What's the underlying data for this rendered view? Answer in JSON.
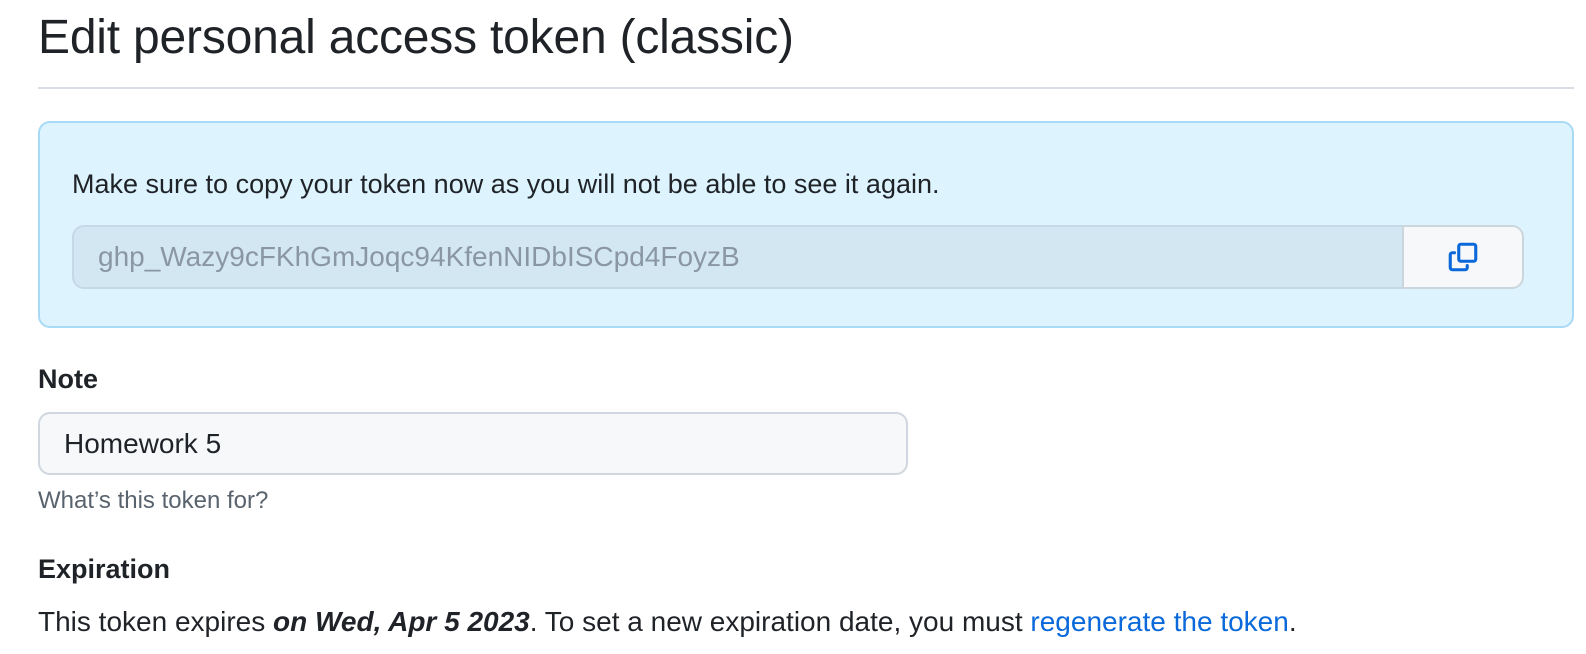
{
  "header": {
    "title": "Edit personal access token (classic)"
  },
  "flash": {
    "message": "Make sure to copy your token now as you will not be able to see it again.",
    "token_value": "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",
    "copy_icon": "copy-icon"
  },
  "note": {
    "label": "Note",
    "value": "Homework 5",
    "hint": "What’s this token for?"
  },
  "expiration": {
    "label": "Expiration",
    "text_prefix": "This token expires ",
    "date": "on Wed, Apr 5 2023",
    "text_middle": ". To set a new expiration date, you must ",
    "link": "regenerate the token",
    "text_suffix": "."
  },
  "colors": {
    "flash_bg": "#ddf4ff",
    "flash_border": "#a8daf5",
    "link": "#0969da",
    "text": "#1f2328",
    "muted": "#59636e"
  }
}
